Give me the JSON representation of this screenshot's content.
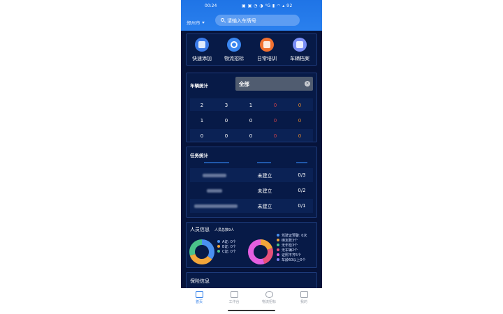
{
  "status_bar": {
    "time": "00:24",
    "icons_text": "▣ ▣ ◔ ◑ ⁴G ▮ ◠ ▴ 92"
  },
  "header": {
    "city": "郑州市",
    "search_placeholder": "请输入车牌号"
  },
  "quick_actions": [
    {
      "label": "快速添加",
      "icon": "add-vehicle-icon"
    },
    {
      "label": "物流招标",
      "icon": "target-icon"
    },
    {
      "label": "日常培训",
      "icon": "training-icon"
    },
    {
      "label": "车辆档案",
      "icon": "truck-icon"
    }
  ],
  "vehicle_stats": {
    "title": "车辆统计",
    "filter_value": "全部",
    "rows": [
      [
        "2",
        "3",
        "1",
        "0",
        "0"
      ],
      [
        "1",
        "0",
        "0",
        "0",
        "0"
      ],
      [
        "0",
        "0",
        "0",
        "0",
        "0"
      ]
    ]
  },
  "task_stats": {
    "title": "任务统计",
    "rows": [
      {
        "status": "未建立",
        "count": "0/3"
      },
      {
        "status": "未建立",
        "count": "0/2"
      },
      {
        "status": "未建立",
        "count": "0/1"
      }
    ]
  },
  "staff_info": {
    "title": "人员信息",
    "total": "人员总数9人",
    "legend_left": [
      {
        "label": "A证: 0个",
        "color": "#4a90f0"
      },
      {
        "label": "B证: 0个",
        "color": "#f2a63a"
      },
      {
        "label": "C证: 0个",
        "color": "#4ac28a"
      }
    ],
    "legend_right": [
      {
        "label": "驾驶证预警: 0次",
        "color": "#4a90f0"
      },
      {
        "label": "绑定数3个",
        "color": "#f2a63a"
      },
      {
        "label": "无年检3个",
        "color": "#4ac28a"
      },
      {
        "label": "无车辆2个",
        "color": "#e8507a"
      },
      {
        "label": "证照不齐5个",
        "color": "#e45fe0"
      },
      {
        "label": "车龄60以上0个",
        "color": "#7a7cf0"
      }
    ],
    "donut_left": [
      {
        "value": 35,
        "color": "#4a90f0"
      },
      {
        "value": 35,
        "color": "#f2a63a"
      },
      {
        "value": 30,
        "color": "#4ac28a"
      }
    ],
    "donut_right": [
      {
        "value": 20,
        "color": "#f2a63a"
      },
      {
        "value": 25,
        "color": "#e8507a"
      },
      {
        "value": 55,
        "color": "#e45fe0"
      }
    ]
  },
  "insurance": {
    "title": "保险信息"
  },
  "tabbar": [
    {
      "label": "首页",
      "icon": "home-icon",
      "active": true
    },
    {
      "label": "工作台",
      "icon": "workbench-icon"
    },
    {
      "label": "物流招标",
      "icon": "planet-icon"
    },
    {
      "label": "我的",
      "icon": "profile-icon"
    }
  ],
  "colors": {
    "accent": "#2a7be8",
    "bg": "#06133a",
    "card": "#071a47",
    "warn_red": "#d2424a",
    "warn_orange": "#e0862d"
  }
}
